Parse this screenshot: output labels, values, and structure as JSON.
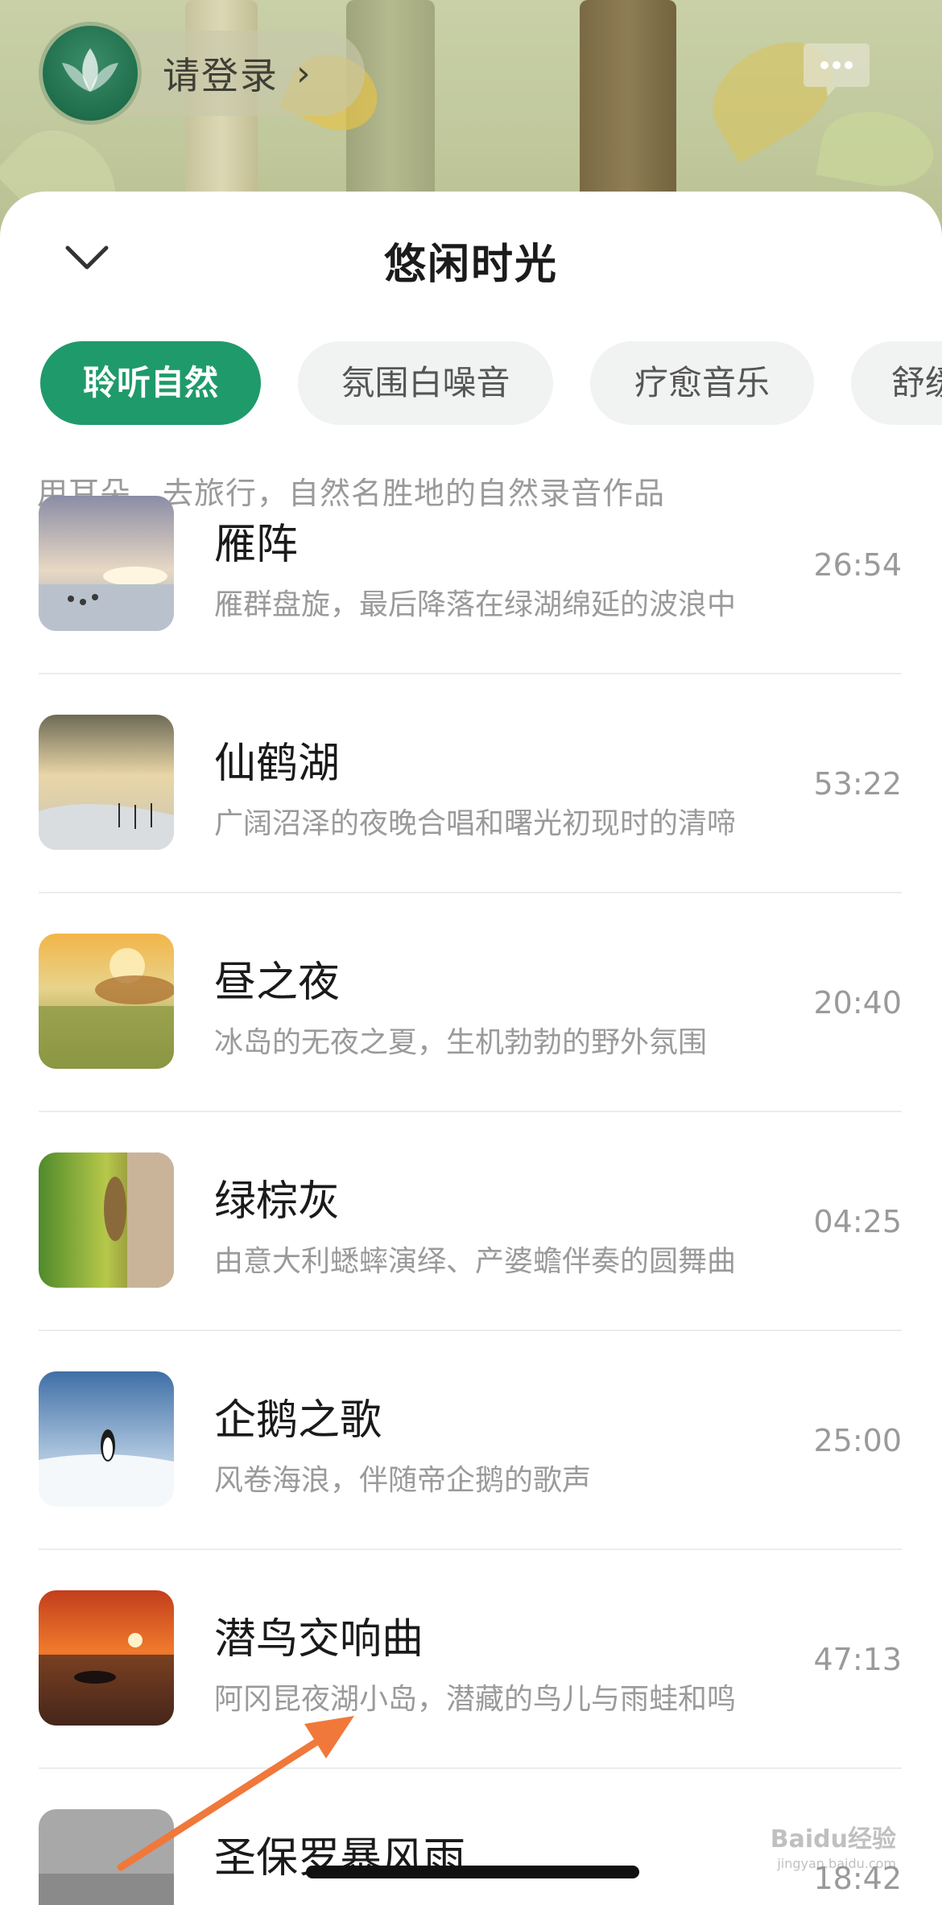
{
  "header": {
    "login_label": "请登录",
    "chevron_glyph": "›"
  },
  "sheet": {
    "title": "悠闲时光",
    "description": "用耳朵，去旅行，自然名胜地的自然录音作品"
  },
  "tabs": [
    {
      "label": "聆听自然",
      "active": true
    },
    {
      "label": "氛围白噪音",
      "active": false
    },
    {
      "label": "疗愈音乐",
      "active": false
    },
    {
      "label": "舒缓",
      "active": false
    }
  ],
  "tracks": [
    {
      "title": "雁阵",
      "subtitle": "雁群盘旋，最后降落在绿湖绵延的波浪中",
      "duration": "26:54"
    },
    {
      "title": "仙鹤湖",
      "subtitle": "广阔沼泽的夜晚合唱和曙光初现时的清啼",
      "duration": "53:22"
    },
    {
      "title": "昼之夜",
      "subtitle": "冰岛的无夜之夏，生机勃勃的野外氛围",
      "duration": "20:40"
    },
    {
      "title": "绿棕灰",
      "subtitle": "由意大利蟋蟀演绎、产婆蟾伴奏的圆舞曲",
      "duration": "04:25"
    },
    {
      "title": "企鹅之歌",
      "subtitle": "风卷海浪，伴随帝企鹅的歌声",
      "duration": "25:00"
    },
    {
      "title": "潜鸟交响曲",
      "subtitle": "阿冈昆夜湖小岛，潜藏的鸟儿与雨蛙和鸣",
      "duration": "47:13"
    },
    {
      "title": "圣保罗暴风雨",
      "subtitle": "",
      "duration": "18:42"
    }
  ],
  "watermark": {
    "brand": "Baidu经验",
    "url": "jingyan.baidu.com"
  },
  "colors": {
    "accent": "#1f9a6b",
    "annotation_arrow": "#f0783a"
  }
}
